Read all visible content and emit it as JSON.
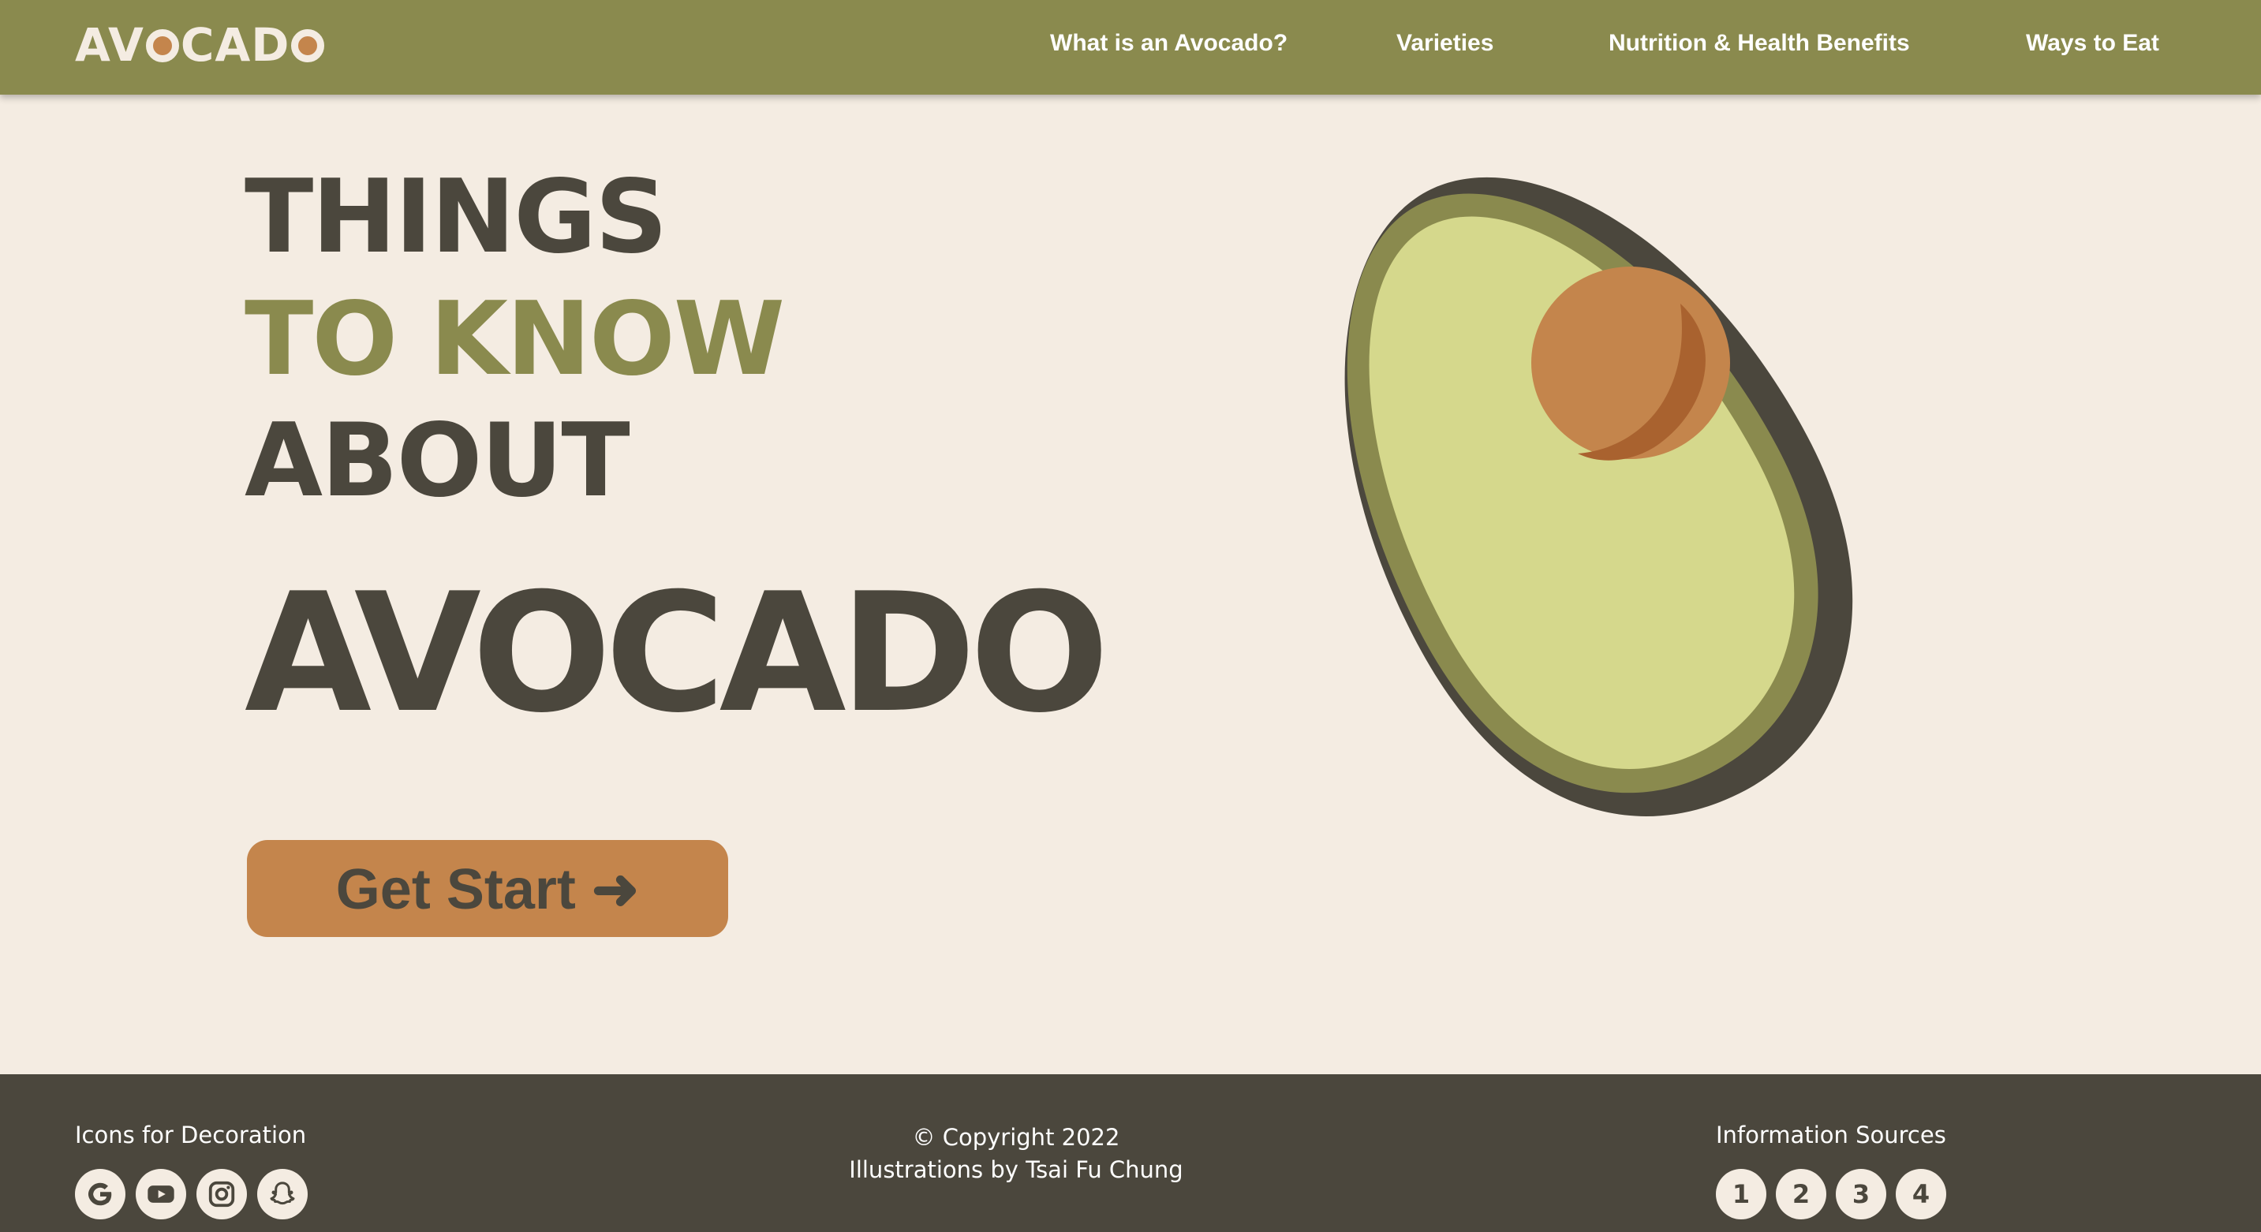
{
  "header": {
    "logo_text": "AVOCADO",
    "nav": [
      {
        "label": "What is an Avocado?"
      },
      {
        "label": "Varieties"
      },
      {
        "label": "Nutrition & Health Benefits"
      },
      {
        "label": "Ways to Eat"
      }
    ]
  },
  "hero": {
    "line1": "THINGS",
    "line2": "TO KNOW",
    "line3": "ABOUT",
    "line4": "AVOCADO",
    "cta_label": "Get Start ➜"
  },
  "footer": {
    "icons_title": "Icons for Decoration",
    "social_icons": [
      "google-icon",
      "youtube-icon",
      "instagram-icon",
      "snapchat-icon"
    ],
    "copyright": "© Copyright 2022",
    "credit": "Illustrations by Tsai Fu Chung",
    "sources_title": "Information Sources",
    "sources": [
      "1",
      "2",
      "3",
      "4"
    ]
  },
  "colors": {
    "olive": "#8A8A4E",
    "cream": "#F4ECE2",
    "dark": "#4B473D",
    "orange": "#C4854C",
    "flesh": "#D5D88C"
  }
}
